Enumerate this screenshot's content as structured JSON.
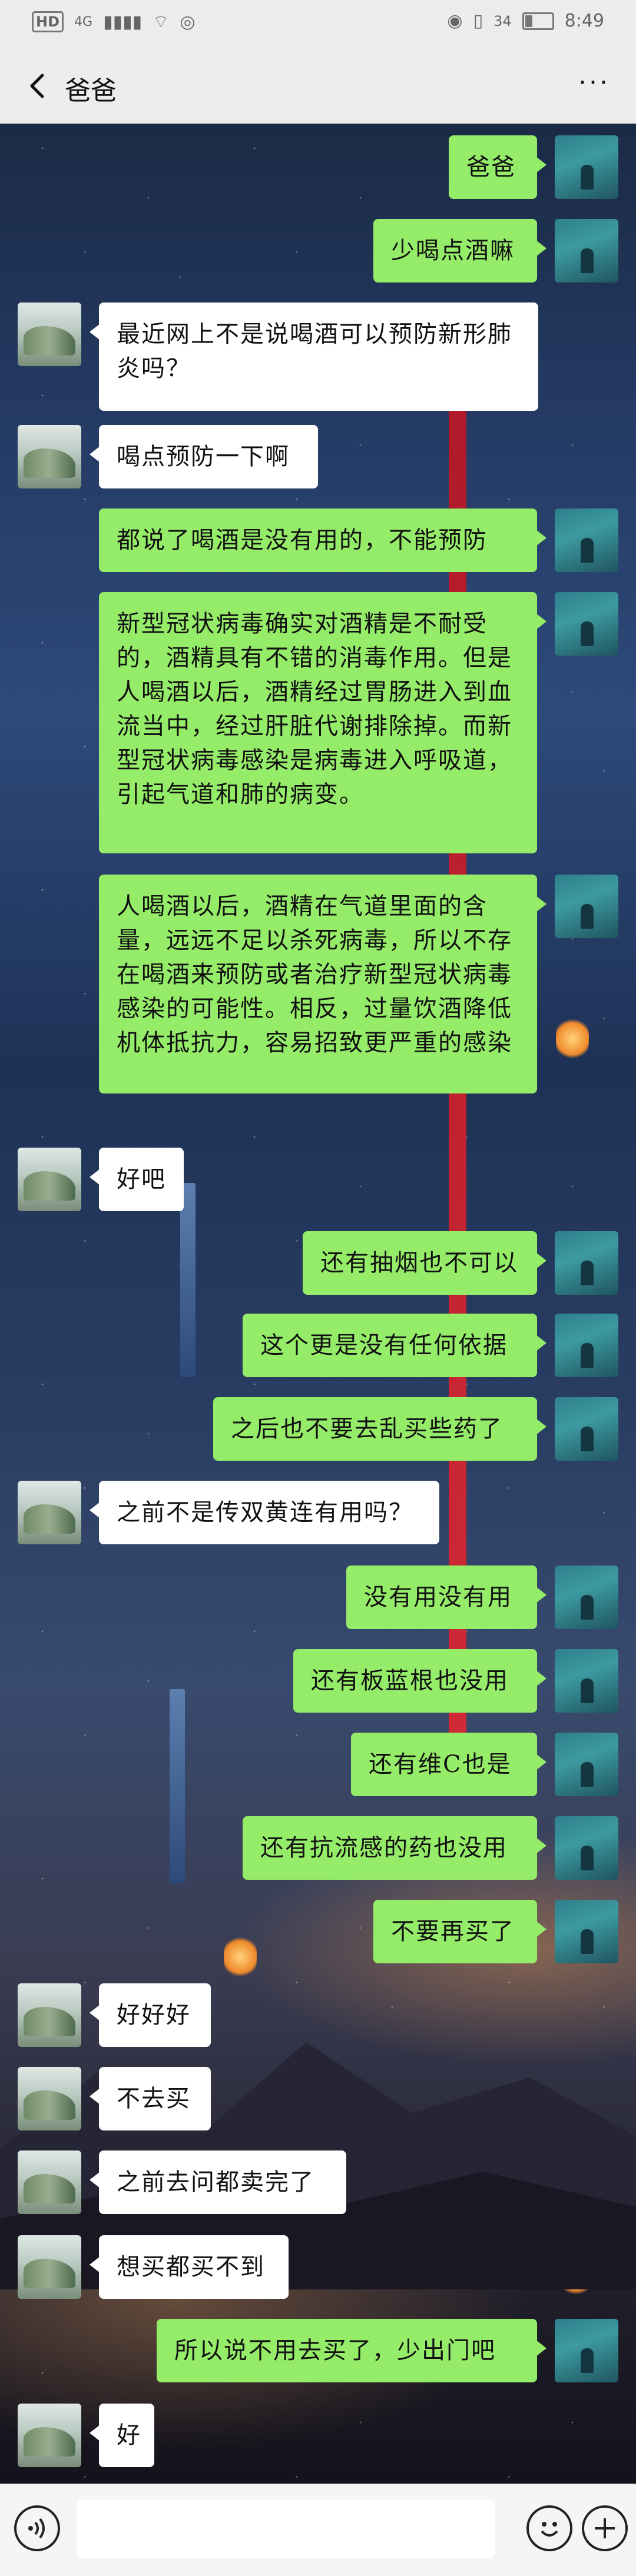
{
  "status_bar": {
    "hd_label": "HD",
    "signal_label": "4G",
    "battery_text": "34",
    "time": "8:49"
  },
  "title_bar": {
    "contact_name": "爸爸",
    "more_label": "···"
  },
  "messages": [
    {
      "from": "me",
      "text": "爸爸"
    },
    {
      "from": "me",
      "text": "少喝点酒嘛"
    },
    {
      "from": "dad",
      "text": "最近网上不是说喝酒可以预防新形肺炎吗？"
    },
    {
      "from": "dad",
      "text": "喝点预防一下啊"
    },
    {
      "from": "me",
      "text": "都说了喝酒是没有用的，不能预防"
    },
    {
      "from": "me",
      "text": "新型冠状病毒确实对酒精是不耐受的，酒精具有不错的消毒作用。但是人喝酒以后，酒精经过胃肠进入到血流当中，经过肝脏代谢排除掉。而新型冠状病毒感染是病毒进入呼吸道，引起气道和肺的病变。"
    },
    {
      "from": "me",
      "text": "人喝酒以后，酒精在气道里面的含量，远远不足以杀死病毒，所以不存在喝酒来预防或者治疗新型冠状病毒感染的可能性。相反，过量饮酒降低机体抵抗力，容易招致更严重的感染"
    },
    {
      "from": "dad",
      "text": "好吧"
    },
    {
      "from": "me",
      "text": "还有抽烟也不可以"
    },
    {
      "from": "me",
      "text": "这个更是没有任何依据"
    },
    {
      "from": "me",
      "text": "之后也不要去乱买些药了"
    },
    {
      "from": "dad",
      "text": "之前不是传双黄连有用吗？"
    },
    {
      "from": "me",
      "text": "没有用没有用"
    },
    {
      "from": "me",
      "text": "还有板蓝根也没用"
    },
    {
      "from": "me",
      "text": "还有维C也是"
    },
    {
      "from": "me",
      "text": "还有抗流感的药也没用"
    },
    {
      "from": "me",
      "text": "不要再买了"
    },
    {
      "from": "dad",
      "text": "好好好"
    },
    {
      "from": "dad",
      "text": "不去买"
    },
    {
      "from": "dad",
      "text": "之前去问都卖完了"
    },
    {
      "from": "dad",
      "text": "想买都买不到"
    },
    {
      "from": "me",
      "text": "所以说不用去买了，少出门吧"
    },
    {
      "from": "dad",
      "text": "好"
    }
  ],
  "input_bar": {
    "voice_icon": "voice-icon",
    "emoji_icon": "emoji-icon",
    "plus_icon": "plus-icon"
  },
  "colors": {
    "my_bubble": "#95ec69",
    "their_bubble": "#ffffff",
    "title_bar": "#ededed"
  }
}
